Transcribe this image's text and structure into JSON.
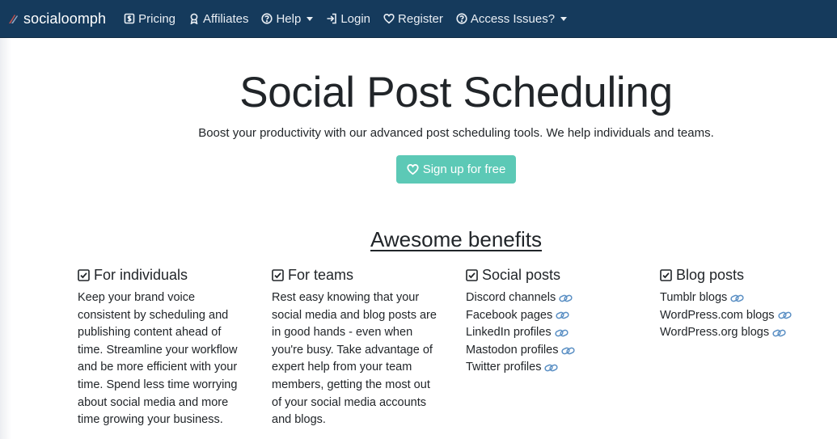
{
  "nav": {
    "brand": "socialoomph",
    "items": [
      {
        "label": "Pricing",
        "icon": "dollar-icon"
      },
      {
        "label": "Affiliates",
        "icon": "award-icon"
      },
      {
        "label": "Help",
        "icon": "question-icon",
        "dropdown": true
      },
      {
        "label": "Login",
        "icon": "login-icon"
      },
      {
        "label": "Register",
        "icon": "heart-icon"
      },
      {
        "label": "Access Issues?",
        "icon": "question-icon",
        "dropdown": true
      }
    ]
  },
  "hero": {
    "title": "Social Post Scheduling",
    "subtitle": "Boost your productivity with our advanced post scheduling tools. We help individuals and teams.",
    "button": "Sign up for free"
  },
  "benefits": {
    "title": "Awesome benefits",
    "individuals": {
      "heading": "For individuals",
      "text": "Keep your brand voice consistent by scheduling and publishing content ahead of time. Streamline your workflow and be more efficient with your time. Spend less time worrying about social media and more time growing your business."
    },
    "teams": {
      "heading": "For teams",
      "text": "Rest easy knowing that your social media and blog posts are in good hands - even when you're busy. Take advantage of expert help from your team members, getting the most out of your social media accounts and blogs."
    },
    "social_posts": {
      "heading": "Social posts",
      "links": [
        "Discord channels",
        "Facebook pages",
        "LinkedIn profiles",
        "Mastodon profiles",
        "Twitter profiles"
      ]
    },
    "blog_posts": {
      "heading": "Blog posts",
      "links": [
        "Tumblr blogs",
        "WordPress.com blogs",
        "WordPress.org blogs"
      ]
    }
  },
  "colors": {
    "navbar": "#153a5c",
    "primary_button": "#5cc9b6",
    "link_icon": "#5a8fc4"
  }
}
